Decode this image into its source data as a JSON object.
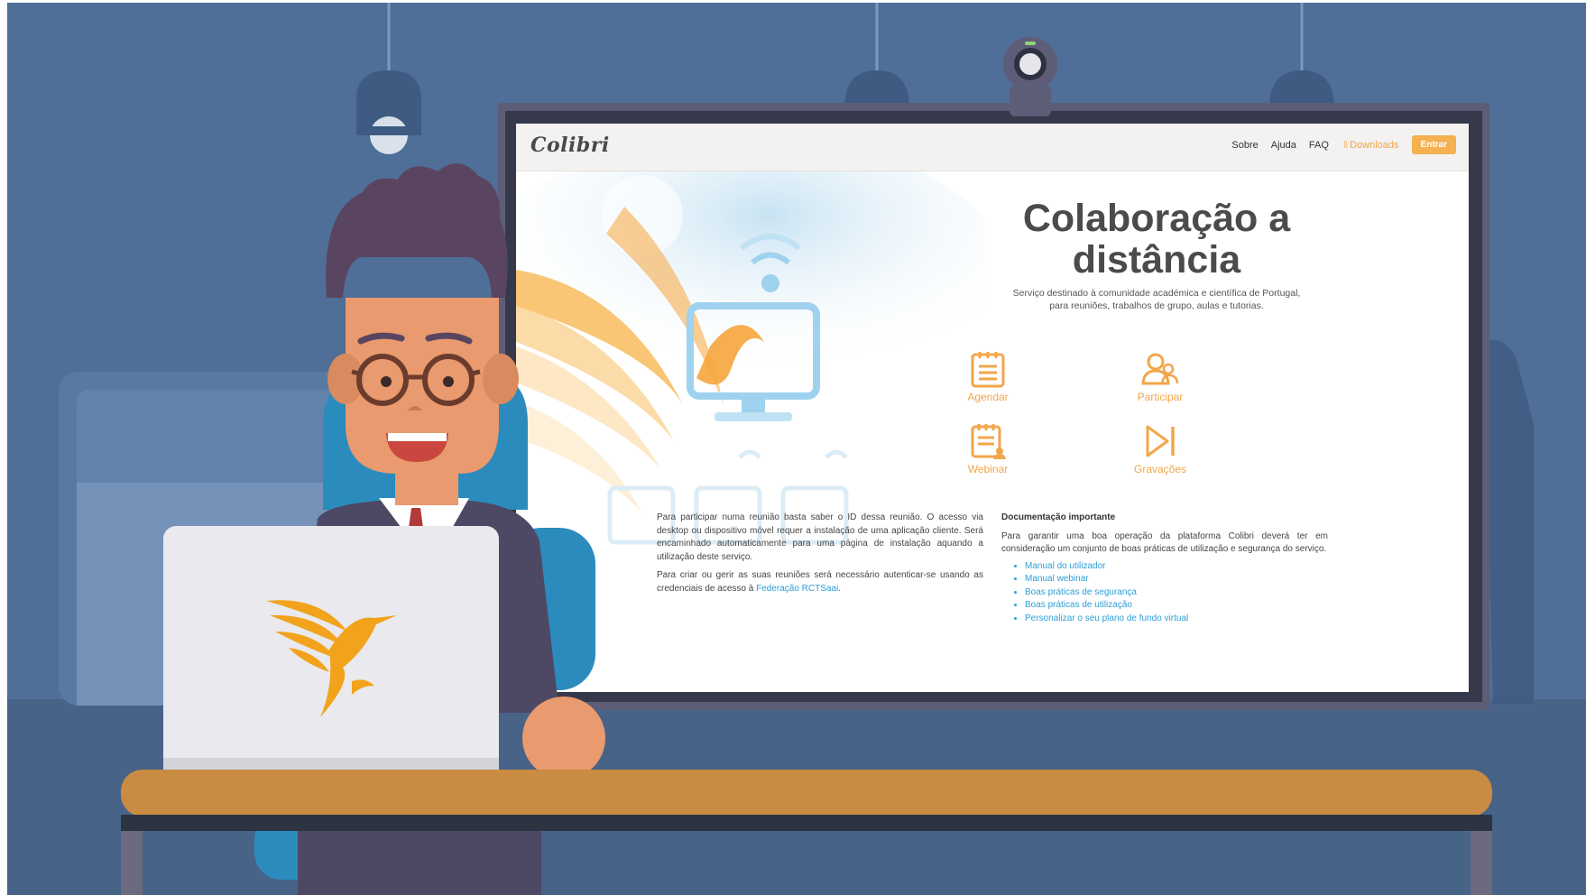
{
  "site": {
    "logo": "Colibri",
    "nav": {
      "sobre": "Sobre",
      "ajuda": "Ajuda",
      "faq": "FAQ",
      "downloads": "Downloads",
      "login": "Entrar"
    },
    "hero": {
      "title_line1": "Colaboração a",
      "title_line2": "distância",
      "subtitle": "Serviço destinado à comunidade académica e científica de Portugal, para reuniões, trabalhos de grupo, aulas e tutorias."
    },
    "features": [
      {
        "label": "Agendar",
        "icon": "calendar-icon"
      },
      {
        "label": "Participar",
        "icon": "participants-icon"
      },
      {
        "label": "Webinar",
        "icon": "webinar-icon"
      },
      {
        "label": "Gravações",
        "icon": "play-recordings-icon"
      }
    ],
    "left_text": {
      "p1": "Para participar numa reunião basta saber o ID dessa reunião. O acesso via desktop ou dispositivo móvel requer a instalação de uma aplicação cliente. Será encaminhado automaticamente para uma página de instalação aquando a utilização deste serviço.",
      "p2_before": "Para criar ou gerir as suas reuniões será necessário autenticar-se usando as credenciais de acesso à ",
      "p2_link": "Federação RCTSaai",
      "p2_after": "."
    },
    "docs": {
      "title": "Documentação importante",
      "intro": "Para garantir uma boa operação da plataforma Colibri deverá ter em consideração um conjunto de boas práticas de utilização e segurança do serviço.",
      "links": [
        "Manual do utilizador",
        "Manual webinar",
        "Boas práticas de segurança",
        "Boas práticas de utilização",
        "Personalizar o seu plano de fundo virtual"
      ]
    }
  },
  "colors": {
    "wall": "#4f6e98",
    "wall_dark": "#445f86",
    "desk_top": "#c98c42",
    "accent_orange": "#f2a64a",
    "link_blue": "#2d9fd6",
    "monitor_frame": "#3c3e52"
  }
}
